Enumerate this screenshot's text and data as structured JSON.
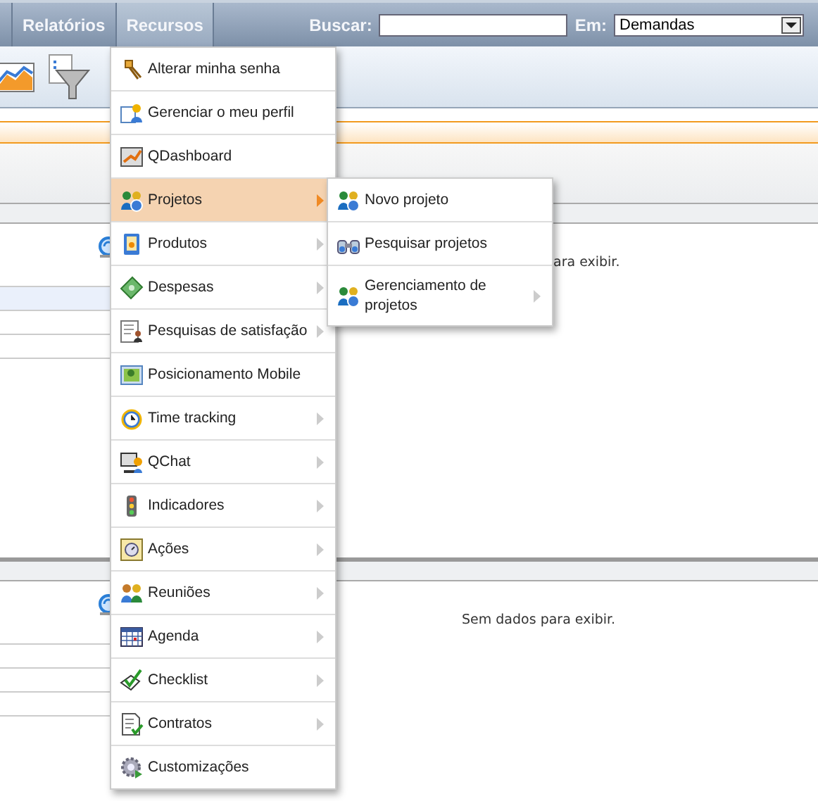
{
  "nav": {
    "items": [
      {
        "label": "Relatórios",
        "selected": false
      },
      {
        "label": "Recursos",
        "selected": true
      }
    ]
  },
  "search": {
    "label": "Buscar:",
    "in_label": "Em:",
    "scope": "Demandas"
  },
  "panels": [
    {
      "message": "ara exibir."
    },
    {
      "message": "Sem dados para exibir."
    }
  ],
  "menu": {
    "items": [
      {
        "label": "Alterar minha senha",
        "has_submenu": false,
        "selected": false
      },
      {
        "label": "Gerenciar o meu perfil",
        "has_submenu": false,
        "selected": false
      },
      {
        "label": "QDashboard",
        "has_submenu": false,
        "selected": false
      },
      {
        "label": "Projetos",
        "has_submenu": true,
        "selected": true
      },
      {
        "label": "Produtos",
        "has_submenu": true,
        "selected": false
      },
      {
        "label": "Despesas",
        "has_submenu": true,
        "selected": false
      },
      {
        "label": "Pesquisas de satisfação",
        "has_submenu": true,
        "selected": false
      },
      {
        "label": "Posicionamento Mobile",
        "has_submenu": false,
        "selected": false
      },
      {
        "label": "Time tracking",
        "has_submenu": true,
        "selected": false
      },
      {
        "label": "QChat",
        "has_submenu": true,
        "selected": false
      },
      {
        "label": "Indicadores",
        "has_submenu": true,
        "selected": false
      },
      {
        "label": "Ações",
        "has_submenu": true,
        "selected": false
      },
      {
        "label": "Reuniões",
        "has_submenu": true,
        "selected": false
      },
      {
        "label": "Agenda",
        "has_submenu": true,
        "selected": false
      },
      {
        "label": "Checklist",
        "has_submenu": true,
        "selected": false
      },
      {
        "label": "Contratos",
        "has_submenu": true,
        "selected": false
      },
      {
        "label": "Customizações",
        "has_submenu": false,
        "selected": false
      }
    ]
  },
  "submenu": {
    "items": [
      {
        "label": "Novo projeto",
        "has_submenu": false
      },
      {
        "label": "Pesquisar projetos",
        "has_submenu": false
      },
      {
        "label": "Gerenciamento de projetos",
        "has_submenu": true
      }
    ]
  }
}
